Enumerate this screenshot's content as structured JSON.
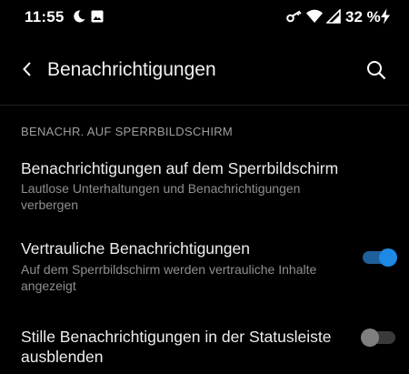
{
  "status_bar": {
    "time": "11:55",
    "battery_text": "32 %",
    "left_icons": [
      "moon-icon",
      "image-icon"
    ],
    "right_icons": [
      "vpn-key-icon",
      "wifi-icon",
      "signal-icon",
      "charging-icon"
    ]
  },
  "app_bar": {
    "title": "Benachrichtigungen",
    "back_icon": "chevron-left-icon",
    "search_icon": "search-icon"
  },
  "section": {
    "header": "BENACHR. AUF SPERRBILDSCHIRM"
  },
  "preferences": [
    {
      "title": "Benachrichtigungen auf dem Sperrbildschirm",
      "summary_line1": "Lautlose Unterhaltungen und Benachrichtigungen",
      "summary_line2": "verbergen"
    },
    {
      "title": "Vertrauliche Benachrichtigungen",
      "summary_line1": "Auf dem Sperrbildschirm werden vertrauliche Inhalte",
      "summary_line2": "angezeigt",
      "toggle_on": true
    },
    {
      "title_line1": "Stille Benachrichtigungen in der Statusleiste",
      "title_line2": "ausblenden",
      "toggle_on": false
    }
  ],
  "colors": {
    "background": "#000000",
    "accent": "#1e88e5",
    "text_primary": "#ededed",
    "text_secondary": "#8f8f8f"
  }
}
